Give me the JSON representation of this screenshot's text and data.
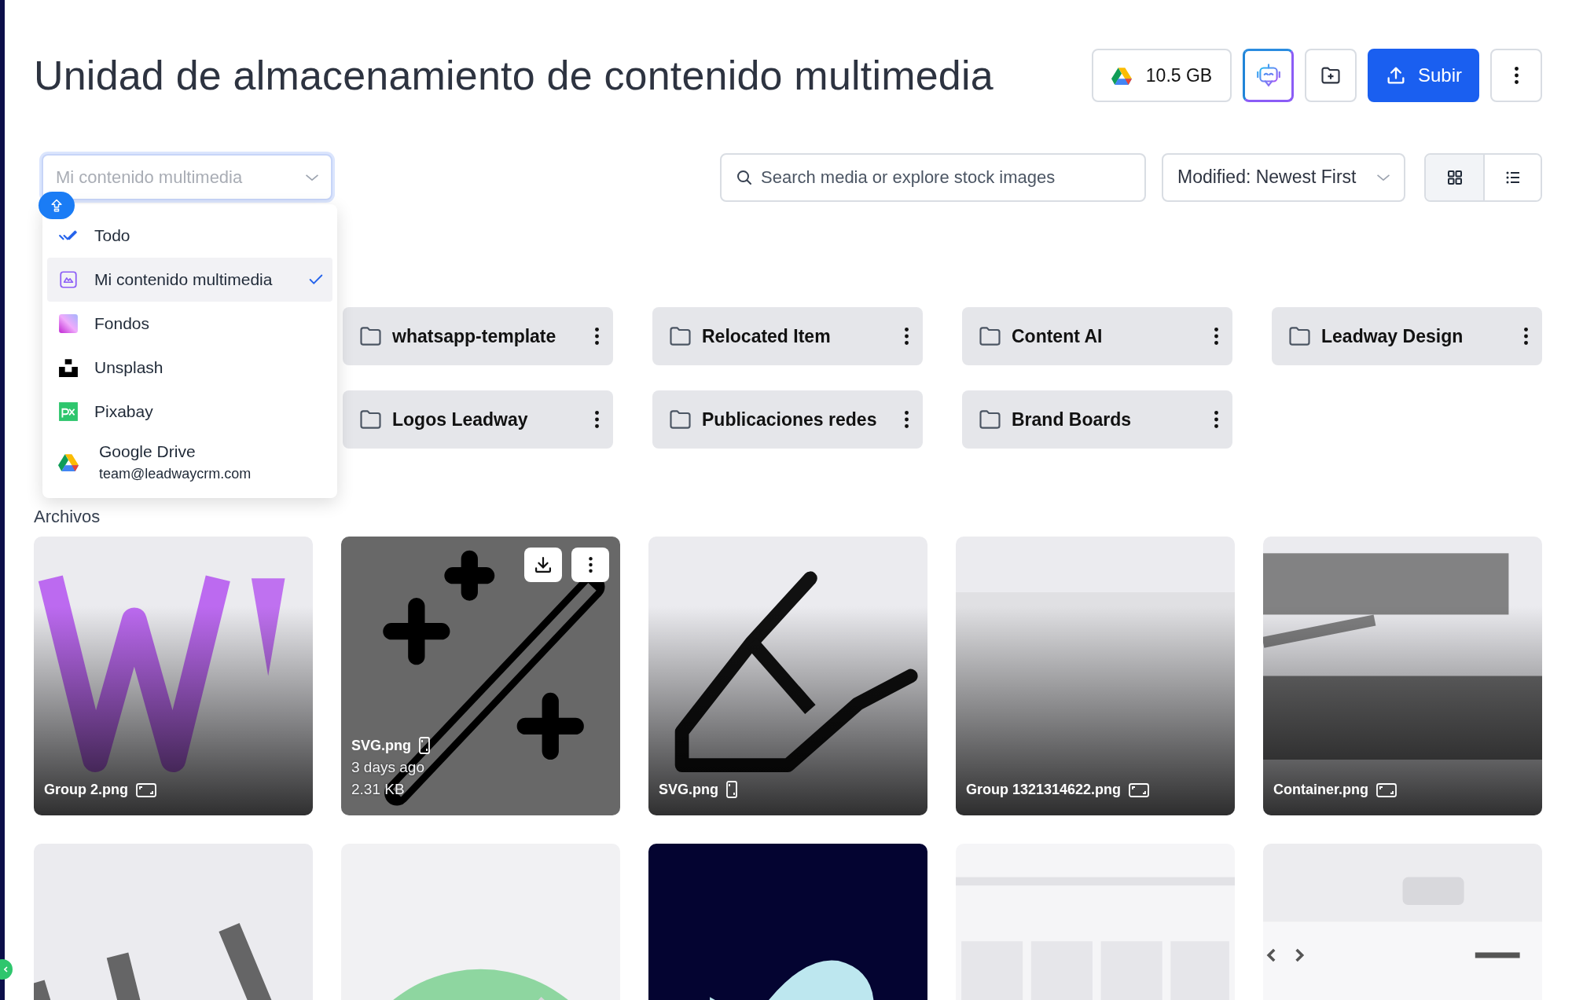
{
  "header": {
    "title": "Unidad de almacenamiento de contenido multimedia",
    "storage": "10.5 GB",
    "upload_button": "Subir"
  },
  "toolbar": {
    "source_select": {
      "placeholder": "Mi contenido multimedia",
      "focused": true
    },
    "search": {
      "placeholder": "Search media or explore stock images"
    },
    "sort": "Modified: Newest First",
    "view_modes": [
      {
        "kind": "grid",
        "selected": true
      },
      {
        "kind": "list",
        "selected": false
      }
    ]
  },
  "source_menu": [
    {
      "kind": "all",
      "label": "Todo",
      "selected": false
    },
    {
      "kind": "mine",
      "label": "Mi contenido multimedia",
      "selected": true
    },
    {
      "kind": "backgrounds",
      "label": "Fondos",
      "selected": false
    },
    {
      "kind": "unsplash",
      "label": "Unsplash",
      "selected": false
    },
    {
      "kind": "pixabay",
      "label": "Pixabay",
      "selected": false
    },
    {
      "kind": "drive",
      "label": "Google Drive",
      "sublabel": "team@leadwaycrm.com",
      "selected": false
    }
  ],
  "folders": [
    {
      "name": "whatsapp-template"
    },
    {
      "name": "Relocated Item"
    },
    {
      "name": "Content AI"
    },
    {
      "name": "Leadway Design"
    },
    {
      "name": "Logos Leadway"
    },
    {
      "name": "Publicaciones redes"
    },
    {
      "name": "Brand Boards"
    }
  ],
  "files_heading": "Archivos",
  "files": [
    {
      "name": "Group 2.png",
      "portrait": false,
      "hovered": false
    },
    {
      "name": "SVG.png",
      "portrait": true,
      "hovered": true,
      "date": "3 days ago",
      "size": "2.31 KB"
    },
    {
      "name": "SVG.png",
      "portrait": true,
      "hovered": false
    },
    {
      "name": "Group 1321314622.png",
      "portrait": false,
      "hovered": false
    },
    {
      "name": "Container.png",
      "portrait": false,
      "hovered": false
    },
    {
      "kind": "picture"
    },
    {
      "kind": "picture"
    },
    {
      "kind": "picture"
    },
    {
      "kind": "picture"
    },
    {
      "kind": "picture"
    }
  ]
}
